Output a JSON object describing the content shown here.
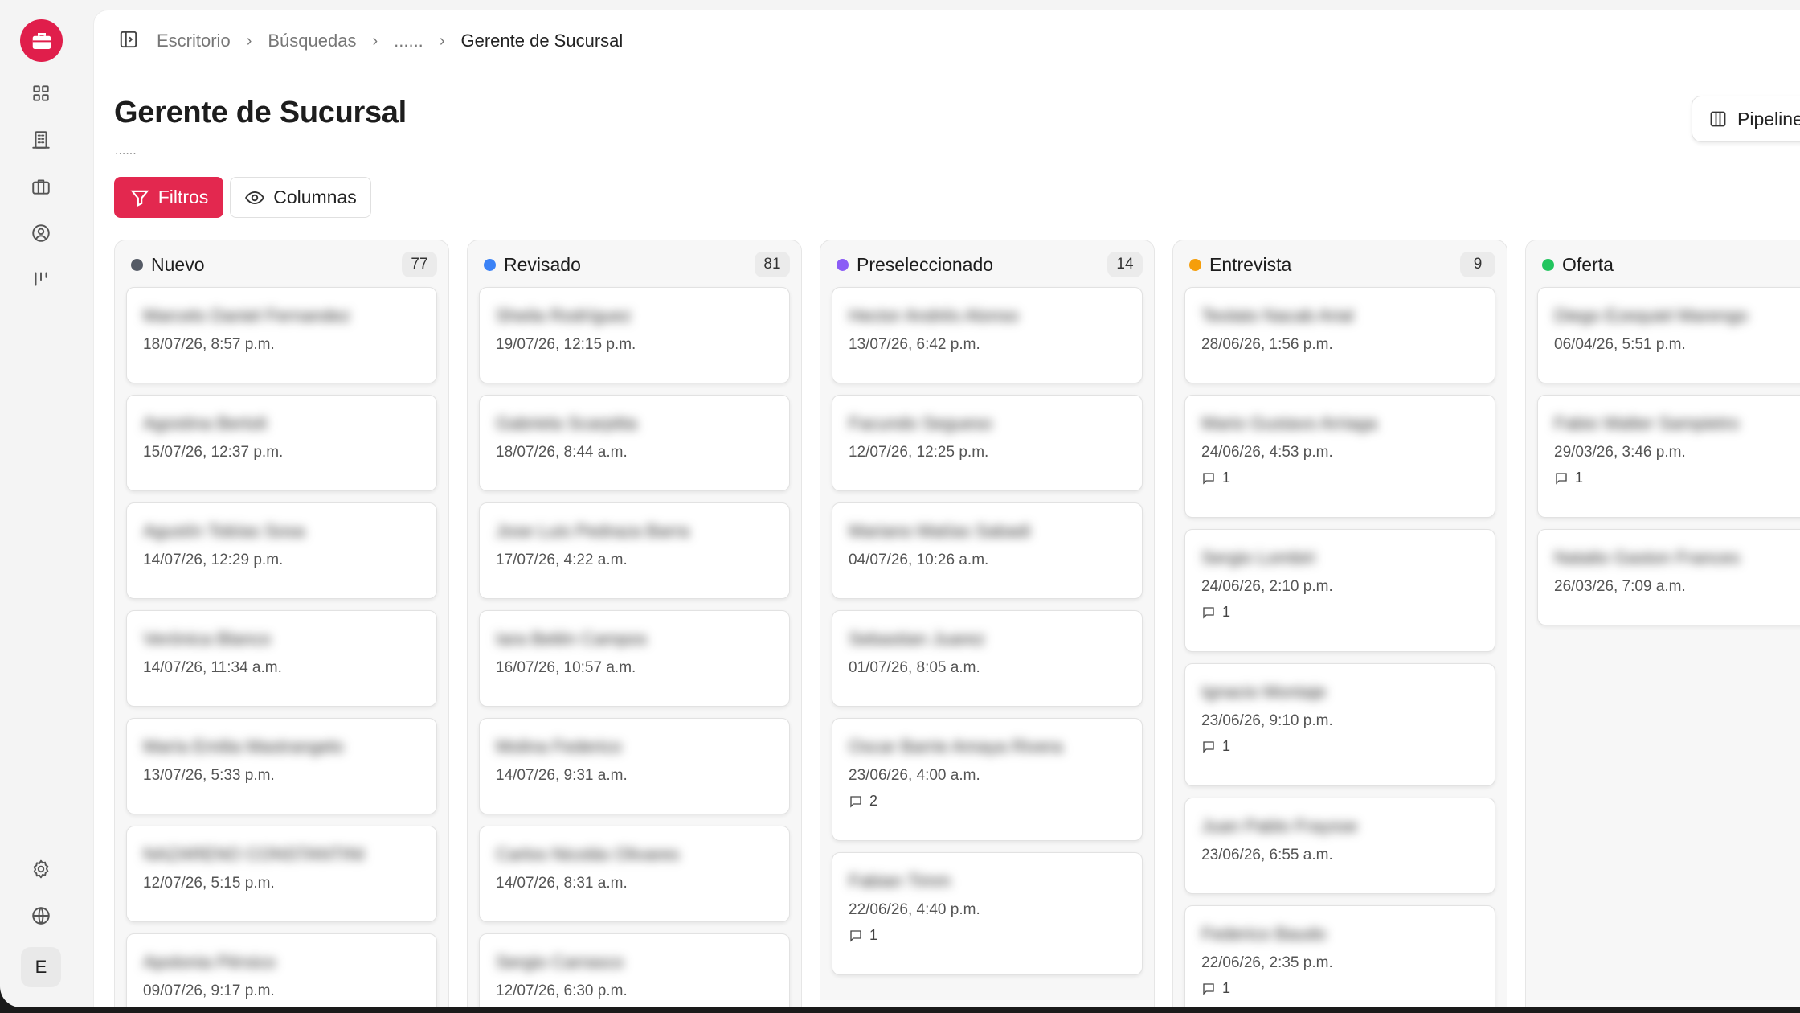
{
  "breadcrumb": [
    "Escritorio",
    "Búsquedas",
    "......",
    "Gerente de Sucursal"
  ],
  "page": {
    "title": "Gerente de Sucursal",
    "subtitle": "......"
  },
  "toolbar": {
    "filters_label": "Filtros",
    "columns_label": "Columnas",
    "pipeline_label": "Pipeline"
  },
  "user": {
    "initial": "E"
  },
  "colors": {
    "brand": "#e01e4b",
    "nuevo": "#555b66",
    "revisado": "#3b82f6",
    "preseleccionado": "#8b5cf6",
    "entrevista": "#f59e0b",
    "oferta": "#22c55e"
  },
  "columns": [
    {
      "title": "Nuevo",
      "count": "77",
      "color": "#555b66",
      "cards": [
        {
          "name": "Marcelo Daniel Fernandez",
          "date": "18/07/26, 8:57 p.m.",
          "comments": ""
        },
        {
          "name": "Agostina Bertoli",
          "date": "15/07/26, 12:37 p.m.",
          "comments": ""
        },
        {
          "name": "Agustín Tobías Sosa",
          "date": "14/07/26, 12:29 p.m.",
          "comments": ""
        },
        {
          "name": "Verónica Blanco",
          "date": "14/07/26, 11:34 a.m.",
          "comments": ""
        },
        {
          "name": "María Emilia Mastrangelo",
          "date": "13/07/26, 5:33 p.m.",
          "comments": ""
        },
        {
          "name": "NAZARENO CONSTANTINI",
          "date": "12/07/26, 5:15 p.m.",
          "comments": ""
        },
        {
          "name": "Apolonia Pérsico",
          "date": "09/07/26, 9:17 p.m.",
          "comments": ""
        }
      ]
    },
    {
      "title": "Revisado",
      "count": "81",
      "color": "#3b82f6",
      "cards": [
        {
          "name": "Sheila Rodríguez",
          "date": "19/07/26, 12:15 p.m.",
          "comments": ""
        },
        {
          "name": "Gabriela Scarpitta",
          "date": "18/07/26, 8:44 a.m.",
          "comments": ""
        },
        {
          "name": "Jose Luis Pedraza Barra",
          "date": "17/07/26, 4:22 a.m.",
          "comments": ""
        },
        {
          "name": "Iara Belén Campos",
          "date": "16/07/26, 10:57 a.m.",
          "comments": ""
        },
        {
          "name": "Molina Federico",
          "date": "14/07/26, 9:31 a.m.",
          "comments": ""
        },
        {
          "name": "Carlos Nicolás Olivares",
          "date": "14/07/26, 8:31 a.m.",
          "comments": ""
        },
        {
          "name": "Sergio Carrasco",
          "date": "12/07/26, 6:30 p.m.",
          "comments": ""
        }
      ]
    },
    {
      "title": "Preseleccionado",
      "count": "14",
      "color": "#8b5cf6",
      "cards": [
        {
          "name": "Hector Andrés Alonso",
          "date": "13/07/26, 6:42 p.m.",
          "comments": ""
        },
        {
          "name": "Facundo Segueso",
          "date": "12/07/26, 12:25 p.m.",
          "comments": ""
        },
        {
          "name": "Mariano Matías Sabadi",
          "date": "04/07/26, 10:26 a.m.",
          "comments": ""
        },
        {
          "name": "Sebastian Juarez",
          "date": "01/07/26, 8:05 a.m.",
          "comments": ""
        },
        {
          "name": "Oscar Barrie Amaya Rivera",
          "date": "23/06/26, 4:00 a.m.",
          "comments": "2"
        },
        {
          "name": "Fabian Timm",
          "date": "22/06/26, 4:40 p.m.",
          "comments": "1"
        }
      ]
    },
    {
      "title": "Entrevista",
      "count": "9",
      "color": "#f59e0b",
      "cards": [
        {
          "name": "Teolato Nacab Arial",
          "date": "28/06/26, 1:56 p.m.",
          "comments": ""
        },
        {
          "name": "Mario Gustavo Arriaga",
          "date": "24/06/26, 4:53 p.m.",
          "comments": "1"
        },
        {
          "name": "Sergio Lombiri",
          "date": "24/06/26, 2:10 p.m.",
          "comments": "1"
        },
        {
          "name": "Ignacio Montaje",
          "date": "23/06/26, 9:10 p.m.",
          "comments": "1"
        },
        {
          "name": "Juan Pablo Fraysse",
          "date": "23/06/26, 6:55 a.m.",
          "comments": ""
        },
        {
          "name": "Federico Baudo",
          "date": "22/06/26, 2:35 p.m.",
          "comments": "1"
        }
      ]
    },
    {
      "title": "Oferta",
      "count": "",
      "color": "#22c55e",
      "cards": [
        {
          "name": "Diego Ezequiel Marengo",
          "date": "06/04/26, 5:51 p.m.",
          "comments": ""
        },
        {
          "name": "Fabio Walter Sampietro",
          "date": "29/03/26, 3:46 p.m.",
          "comments": "1"
        },
        {
          "name": "Natalio Gaston Frances",
          "date": "26/03/26, 7:09 a.m.",
          "comments": ""
        }
      ]
    }
  ]
}
